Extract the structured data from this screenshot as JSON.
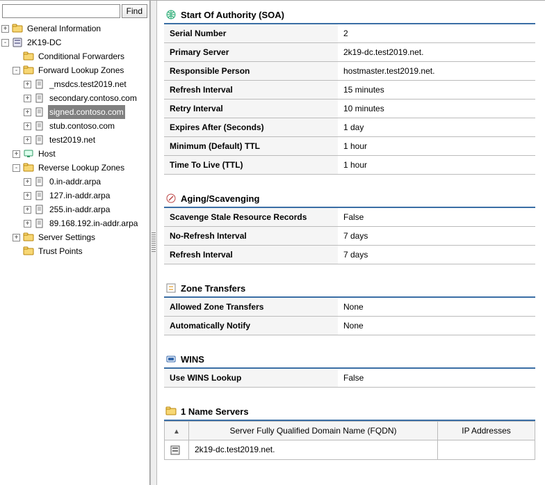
{
  "sidebar": {
    "search": {
      "value": "",
      "find_label": "Find"
    },
    "nodes": [
      {
        "id": "gi",
        "depth": 0,
        "toggle": "+",
        "icon": "folder",
        "label": "General Information"
      },
      {
        "id": "srv",
        "depth": 0,
        "toggle": "-",
        "icon": "server",
        "label": "2K19-DC"
      },
      {
        "id": "cf",
        "depth": 1,
        "toggle": " ",
        "icon": "folder",
        "label": "Conditional Forwarders"
      },
      {
        "id": "flz",
        "depth": 1,
        "toggle": "-",
        "icon": "folder",
        "label": "Forward Lookup Zones"
      },
      {
        "id": "z1",
        "depth": 2,
        "toggle": "+",
        "icon": "doc",
        "label": "_msdcs.test2019.net"
      },
      {
        "id": "z2",
        "depth": 2,
        "toggle": "+",
        "icon": "doc",
        "label": "secondary.contoso.com"
      },
      {
        "id": "z3",
        "depth": 2,
        "toggle": "+",
        "icon": "doc",
        "label": "signed.contoso.com",
        "selected": true
      },
      {
        "id": "z4",
        "depth": 2,
        "toggle": "+",
        "icon": "doc",
        "label": "stub.contoso.com"
      },
      {
        "id": "z5",
        "depth": 2,
        "toggle": "+",
        "icon": "doc",
        "label": "test2019.net"
      },
      {
        "id": "hst",
        "depth": 1,
        "toggle": "+",
        "icon": "host",
        "label": "Host"
      },
      {
        "id": "rlz",
        "depth": 1,
        "toggle": "-",
        "icon": "folder",
        "label": "Reverse Lookup Zones"
      },
      {
        "id": "r1",
        "depth": 2,
        "toggle": "+",
        "icon": "doc",
        "label": "0.in-addr.arpa"
      },
      {
        "id": "r2",
        "depth": 2,
        "toggle": "+",
        "icon": "doc",
        "label": "127.in-addr.arpa"
      },
      {
        "id": "r3",
        "depth": 2,
        "toggle": "+",
        "icon": "doc",
        "label": "255.in-addr.arpa"
      },
      {
        "id": "r4",
        "depth": 2,
        "toggle": "+",
        "icon": "doc",
        "label": "89.168.192.in-addr.arpa"
      },
      {
        "id": "ss",
        "depth": 1,
        "toggle": "+",
        "icon": "folder",
        "label": "Server Settings"
      },
      {
        "id": "tp",
        "depth": 1,
        "toggle": " ",
        "icon": "folder",
        "label": "Trust Points"
      }
    ]
  },
  "sections": {
    "soa": {
      "title": "Start Of Authority (SOA)",
      "rows": [
        {
          "k": "Serial Number",
          "v": "2"
        },
        {
          "k": "Primary Server",
          "v": "2k19-dc.test2019.net."
        },
        {
          "k": "Responsible Person",
          "v": "hostmaster.test2019.net."
        },
        {
          "k": "Refresh Interval",
          "v": "15 minutes"
        },
        {
          "k": "Retry Interval",
          "v": "10 minutes"
        },
        {
          "k": "Expires After (Seconds)",
          "v": "1 day"
        },
        {
          "k": "Minimum (Default) TTL",
          "v": "1 hour"
        },
        {
          "k": "Time To Live (TTL)",
          "v": "1 hour"
        }
      ]
    },
    "aging": {
      "title": "Aging/Scavenging",
      "rows": [
        {
          "k": "Scavenge Stale Resource Records",
          "v": "False"
        },
        {
          "k": "No-Refresh Interval",
          "v": "7 days"
        },
        {
          "k": "Refresh Interval",
          "v": "7 days"
        }
      ]
    },
    "zt": {
      "title": "Zone Transfers",
      "rows": [
        {
          "k": "Allowed Zone Transfers",
          "v": "None"
        },
        {
          "k": "Automatically Notify",
          "v": "None"
        }
      ]
    },
    "wins": {
      "title": "WINS",
      "rows": [
        {
          "k": "Use WINS Lookup",
          "v": "False"
        }
      ]
    },
    "ns": {
      "title": "1 Name Servers",
      "columns": {
        "fqdn": "Server Fully Qualified Domain Name (FQDN)",
        "ip": "IP Addresses"
      },
      "rows": [
        {
          "fqdn": "2k19-dc.test2019.net.",
          "ip": ""
        }
      ]
    }
  }
}
